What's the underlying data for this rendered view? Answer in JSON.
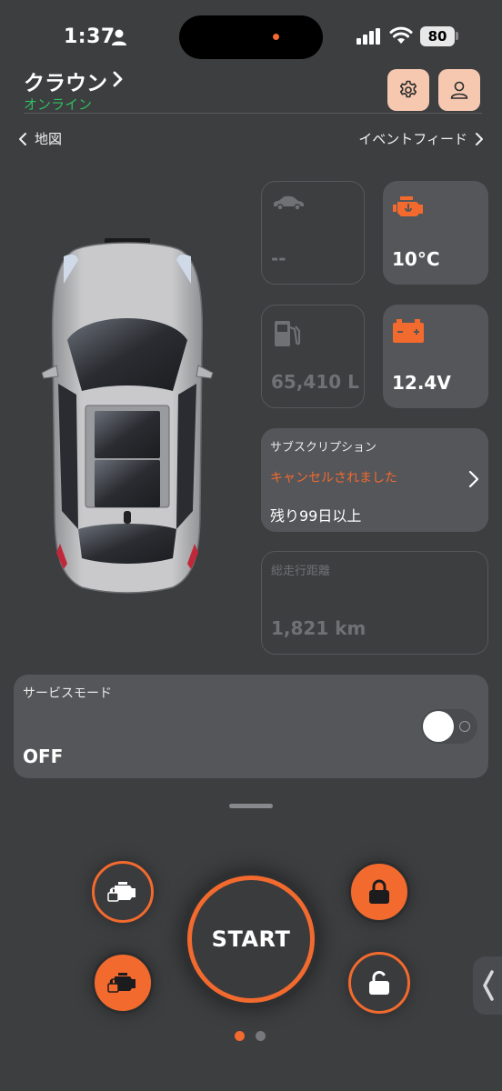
{
  "status_bar": {
    "time": "1:37",
    "battery": "80"
  },
  "header": {
    "title": "クラウン",
    "status": "オンライン",
    "status_color": "#2fbf61",
    "settings_icon": "gear-icon",
    "account_icon": "person-icon"
  },
  "nav": {
    "back_label": "地図",
    "feed_label": "イベントフィード"
  },
  "tiles": {
    "car_status": {
      "value": "--"
    },
    "engine_temp": {
      "value": "10°C"
    },
    "fuel": {
      "value": "65,410 L"
    },
    "battery_voltage": {
      "value": "12.4V"
    },
    "subscription": {
      "title": "サブスクリプション",
      "status": "キャンセルされました",
      "remaining": "残り99日以上"
    },
    "odometer": {
      "title": "総走行距離",
      "value": "1,821 km"
    }
  },
  "service_mode": {
    "title": "サービスモード",
    "value": "OFF",
    "enabled": false
  },
  "controls": {
    "start_label": "START",
    "engine_off_icon": "engine-lock-icon",
    "engine_on_icon": "engine-lock-icon",
    "lock_icon": "lock-icon",
    "unlock_icon": "unlock-icon"
  },
  "pager": {
    "pages": 2,
    "active": 1
  },
  "colors": {
    "accent": "#f26a2e",
    "background": "#3d3e40",
    "tile": "#555659",
    "online": "#2fbf61"
  }
}
